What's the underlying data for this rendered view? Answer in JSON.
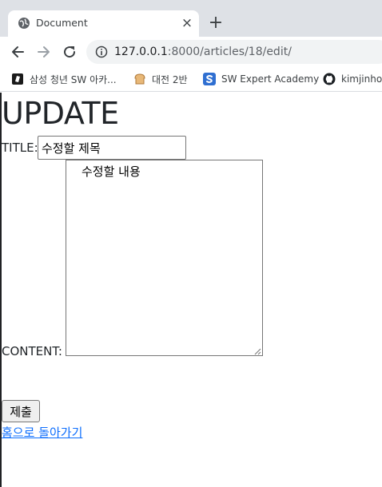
{
  "browser": {
    "tab": {
      "title": "Document",
      "close_glyph": "×",
      "favicon": "globe-icon"
    },
    "new_tab_glyph": "+",
    "address": {
      "host": "127.0.0.1",
      "rest": ":8000/articles/18/edit/"
    },
    "bookmarks": [
      {
        "label": "삼성 청년 SW 아카...",
        "icon": "ssafy-icon"
      },
      {
        "label": "대전 2반",
        "icon": "bread-icon"
      },
      {
        "label": "SW Expert Academy",
        "icon": "swea-icon"
      },
      {
        "label": "kimjinho-",
        "icon": "github-icon"
      }
    ]
  },
  "page": {
    "heading": "UPDATE",
    "title_label": "TITLE:",
    "title_value": "수정할 제목",
    "content_label": "CONTENT:",
    "content_value": "수정할 내용",
    "submit_label": "제출",
    "back_link": "홈으로 돌아가기"
  },
  "colors": {
    "tabstrip": "#dee1e6",
    "omnibox": "#f1f3f4",
    "link": "#0d6efd",
    "text": "#212529"
  }
}
